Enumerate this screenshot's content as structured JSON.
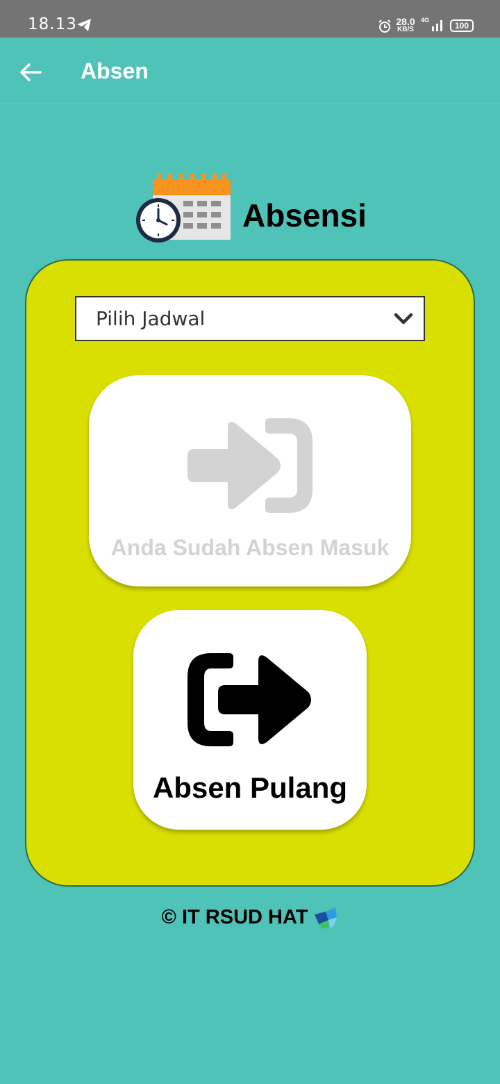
{
  "status_bar": {
    "time": "18.13",
    "net_speed_value": "28.0",
    "net_speed_unit": "KB/S",
    "network_type": "4G",
    "battery": "100"
  },
  "app_bar": {
    "title": "Absen",
    "back_icon": "arrow-left-icon"
  },
  "header": {
    "title": "Absensi",
    "logo_icon": "calendar-clock-icon"
  },
  "schedule_select": {
    "selected": "Pilih Jadwal",
    "icon": "chevron-down-icon"
  },
  "checkin": {
    "label": "Anda Sudah Absen Masuk",
    "icon": "sign-in-icon",
    "enabled": false
  },
  "checkout": {
    "label": "Absen Pulang",
    "icon": "sign-out-icon",
    "enabled": true
  },
  "footer": {
    "text": "© IT RSUD HAT",
    "logo_icon": "hospital-logo-icon"
  },
  "colors": {
    "background": "#4fc3b8",
    "panel": "#d9df00",
    "disabled": "#d3d3d3"
  }
}
